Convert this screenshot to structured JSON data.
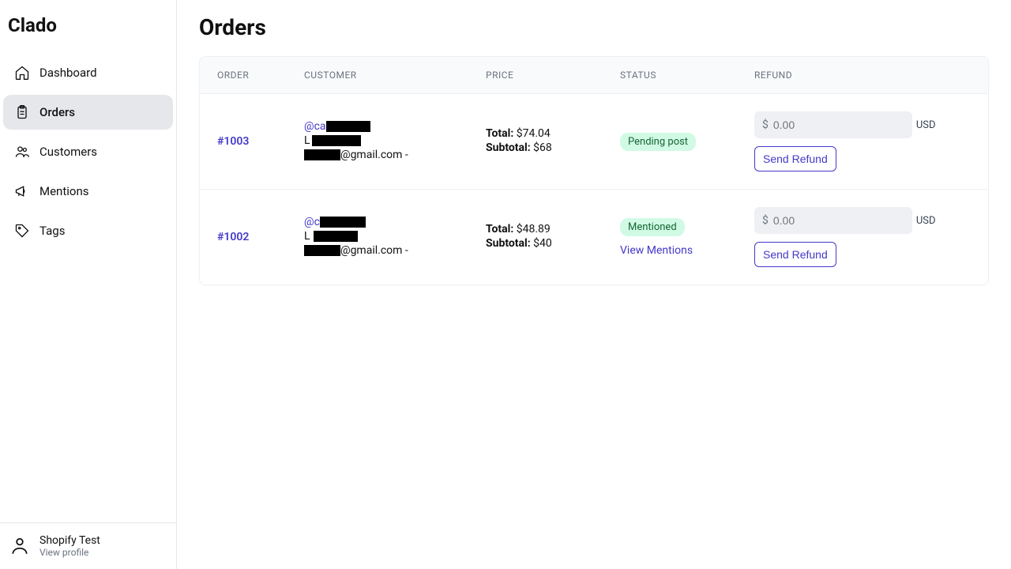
{
  "brand": "Clado",
  "nav": [
    {
      "key": "dashboard",
      "label": "Dashboard",
      "icon": "home-icon"
    },
    {
      "key": "orders",
      "label": "Orders",
      "icon": "clipboard-icon",
      "active": true
    },
    {
      "key": "customers",
      "label": "Customers",
      "icon": "users-icon"
    },
    {
      "key": "mentions",
      "label": "Mentions",
      "icon": "megaphone-icon"
    },
    {
      "key": "tags",
      "label": "Tags",
      "icon": "tag-icon"
    }
  ],
  "footer": {
    "name": "Shopify Test",
    "sub": "View profile"
  },
  "page": {
    "title": "Orders"
  },
  "table": {
    "headers": {
      "order": "ORDER",
      "customer": "CUSTOMER",
      "price": "PRICE",
      "status": "STATUS",
      "refund": "REFUND"
    },
    "price_labels": {
      "total": "Total:",
      "subtotal": "Subtotal:"
    },
    "refund": {
      "prefix": "$",
      "placeholder": "0.00",
      "currency": "USD",
      "button": "Send Refund"
    },
    "view_mentions": "View Mentions",
    "rows": [
      {
        "order_id": "#1003",
        "handle_prefix": "@ca",
        "name_prefix": "L",
        "email_suffix": "@gmail.com -",
        "total": "$74.04",
        "subtotal": "$68",
        "status": "Pending post",
        "show_mentions_link": false
      },
      {
        "order_id": "#1002",
        "handle_prefix": "@c",
        "name_prefix": "L",
        "email_suffix": "@gmail.com -",
        "total": "$48.89",
        "subtotal": "$40",
        "status": "Mentioned",
        "show_mentions_link": true
      }
    ]
  }
}
